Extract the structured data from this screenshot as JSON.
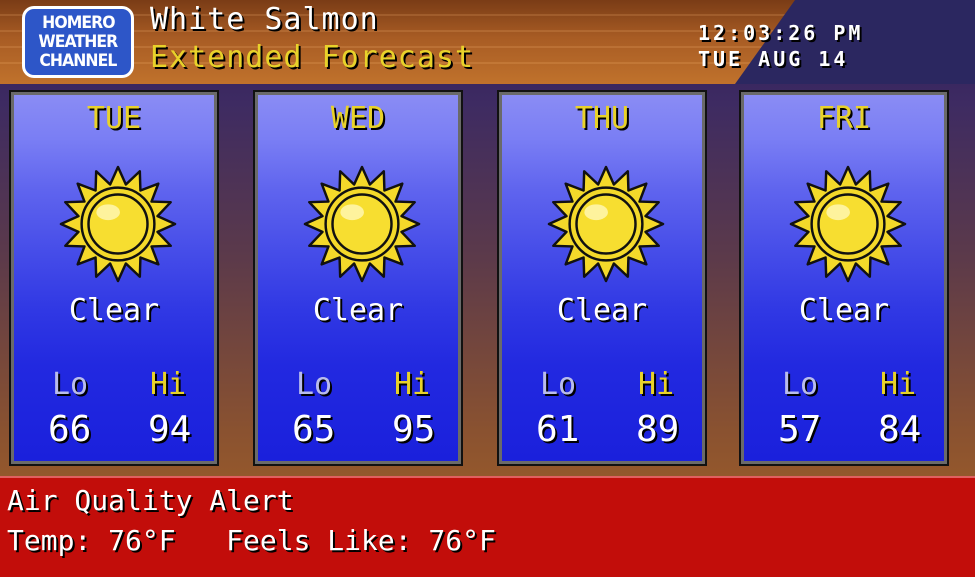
{
  "header": {
    "logo_lines": [
      "HOMERO",
      "WEATHER",
      "CHANNEL"
    ],
    "location": "White Salmon",
    "subtitle": "Extended Forecast",
    "time": "12:03:26 PM",
    "date": "TUE AUG 14"
  },
  "labels": {
    "lo": "Lo",
    "hi": "Hi"
  },
  "forecast": [
    {
      "day": "TUE",
      "condition": "Clear",
      "icon": "sun-icon",
      "lo": "66",
      "hi": "94"
    },
    {
      "day": "WED",
      "condition": "Clear",
      "icon": "sun-icon",
      "lo": "65",
      "hi": "95"
    },
    {
      "day": "THU",
      "condition": "Clear",
      "icon": "sun-icon",
      "lo": "61",
      "hi": "89"
    },
    {
      "day": "FRI",
      "condition": "Clear",
      "icon": "sun-icon",
      "lo": "57",
      "hi": "84"
    }
  ],
  "alert": {
    "title": "Air Quality Alert",
    "line": "Temp: 76°F   Feels Like: 76°F"
  },
  "colors": {
    "title_yellow": "#e8d22a",
    "alert_red": "#c20d0a",
    "panel_blue": "#1d27e0"
  }
}
